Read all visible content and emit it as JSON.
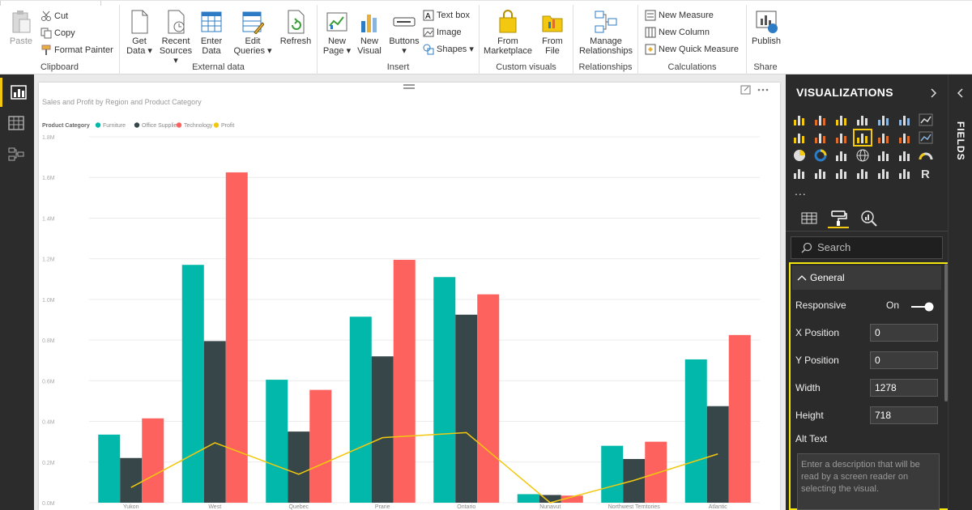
{
  "ribbon": {
    "clipboard": {
      "title": "Clipboard",
      "paste": "Paste",
      "cut": "Cut",
      "copy": "Copy",
      "format_painter": "Format Painter"
    },
    "external_data": {
      "title": "External data",
      "get_data_1": "Get",
      "get_data_2": "Data",
      "recent_1": "Recent",
      "recent_2": "Sources",
      "enter_1": "Enter",
      "enter_2": "Data",
      "edit_1": "Edit",
      "edit_2": "Queries",
      "refresh": "Refresh"
    },
    "insert": {
      "title": "Insert",
      "new_page_1": "New",
      "new_page_2": "Page",
      "new_visual_1": "New",
      "new_visual_2": "Visual",
      "buttons": "Buttons",
      "text_box": "Text box",
      "image": "Image",
      "shapes": "Shapes"
    },
    "custom_visuals": {
      "title": "Custom visuals",
      "marketplace_1": "From",
      "marketplace_2": "Marketplace",
      "file_1": "From",
      "file_2": "File"
    },
    "relationships": {
      "title": "Relationships",
      "manage_1": "Manage",
      "manage_2": "Relationships"
    },
    "calculations": {
      "title": "Calculations",
      "new_measure": "New Measure",
      "new_column": "New Column",
      "new_quick_measure": "New Quick Measure"
    },
    "share": {
      "title": "Share",
      "publish": "Publish"
    }
  },
  "visualizations": {
    "title": "VISUALIZATIONS",
    "search_placeholder": "Search",
    "more": "...",
    "general": {
      "header": "General",
      "responsive_label": "Responsive",
      "responsive_value": "On",
      "x_label": "X Position",
      "x_value": "0",
      "y_label": "Y Position",
      "y_value": "0",
      "width_label": "Width",
      "width_value": "1278",
      "height_label": "Height",
      "height_value": "718",
      "alt_label": "Alt Text",
      "alt_placeholder": "Enter a description that will be read by a screen reader on selecting the visual."
    }
  },
  "fields": {
    "title": "FIELDS"
  },
  "colors": {
    "accent": "#f2c811",
    "furniture": "#01b8aa",
    "office": "#374649",
    "technology": "#fd625e",
    "profit": "#f2c80f"
  },
  "chart_data": {
    "type": "bar",
    "title": "Sales and Profit by Region and Product Category",
    "legend_title": "Product Category",
    "categories": [
      "Yukon",
      "West",
      "Quebec",
      "Prarie",
      "Ontario",
      "Nunavut",
      "Northwest Territories",
      "Atlantic"
    ],
    "series": [
      {
        "name": "Furniture",
        "values": [
          335000,
          1170000,
          605000,
          915000,
          1110000,
          42000,
          280000,
          705000
        ]
      },
      {
        "name": "Office Supplies",
        "values": [
          220000,
          795000,
          350000,
          720000,
          925000,
          38000,
          215000,
          475000
        ]
      },
      {
        "name": "Technology",
        "values": [
          415000,
          1625000,
          555000,
          1195000,
          1025000,
          35000,
          300000,
          825000
        ]
      }
    ],
    "line_series": {
      "name": "Profit",
      "values": [
        75000,
        295000,
        140000,
        320000,
        345000,
        0,
        110000,
        240000
      ]
    },
    "yticks": [
      "0.0M",
      "0.2M",
      "0.4M",
      "0.6M",
      "0.8M",
      "1.0M",
      "1.2M",
      "1.4M",
      "1.6M",
      "1.8M"
    ],
    "ylim": [
      0,
      1800000
    ],
    "legend": "top-left",
    "grid": true
  }
}
